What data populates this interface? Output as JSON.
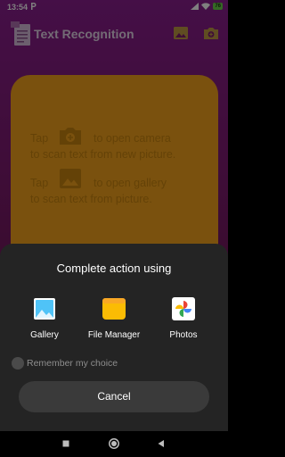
{
  "status_bar": {
    "time": "13:54",
    "battery": "76",
    "icons": [
      "p-icon",
      "signal-icon",
      "wifi-icon",
      "battery-icon"
    ]
  },
  "app_bar": {
    "title": "Text Recognition",
    "actions": [
      "gallery-icon",
      "camera-icon"
    ]
  },
  "card": {
    "line1_a": "Tap",
    "line1_b": "to open camera",
    "line2": "to scan text from new picture.",
    "line3_a": "Tap",
    "line3_b": "to open gallery",
    "line4": "to scan text from picture."
  },
  "chooser": {
    "title": "Complete action using",
    "targets": [
      {
        "label": "Gallery",
        "icon": "gallery-app-icon"
      },
      {
        "label": "File Manager",
        "icon": "folder-icon"
      },
      {
        "label": "Photos",
        "icon": "photos-pinwheel-icon"
      }
    ],
    "remember_label": "Remember my choice",
    "remember_checked": false,
    "cancel_label": "Cancel"
  },
  "nav_bar": {
    "buttons": [
      "recents-square-icon",
      "home-circle-icon",
      "back-triangle-icon"
    ]
  },
  "colors": {
    "app_gradient_top": "#8a1e8e",
    "card": "#f5a21c",
    "sheet": "#242424",
    "cancel_button": "#3a3a3a"
  }
}
